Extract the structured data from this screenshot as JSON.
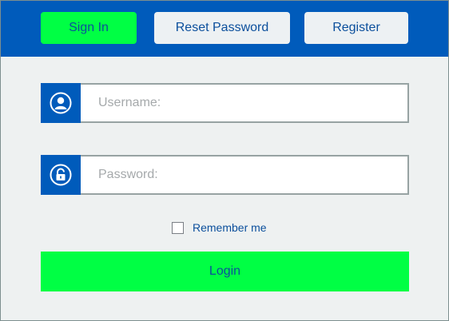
{
  "tabs": {
    "sign_in": "Sign In",
    "reset_password": "Reset Password",
    "register": "Register",
    "active": "sign_in"
  },
  "form": {
    "username_placeholder": "Username:",
    "password_placeholder": "Password:",
    "username_icon": "user-icon",
    "password_icon": "unlock-icon",
    "remember_label": "Remember me",
    "remember_checked": false,
    "login_label": "Login"
  },
  "colors": {
    "brand_blue": "#005bbb",
    "accent_green": "#00ff44",
    "background": "#eef1f1",
    "text_blue": "#0b4f9c"
  }
}
